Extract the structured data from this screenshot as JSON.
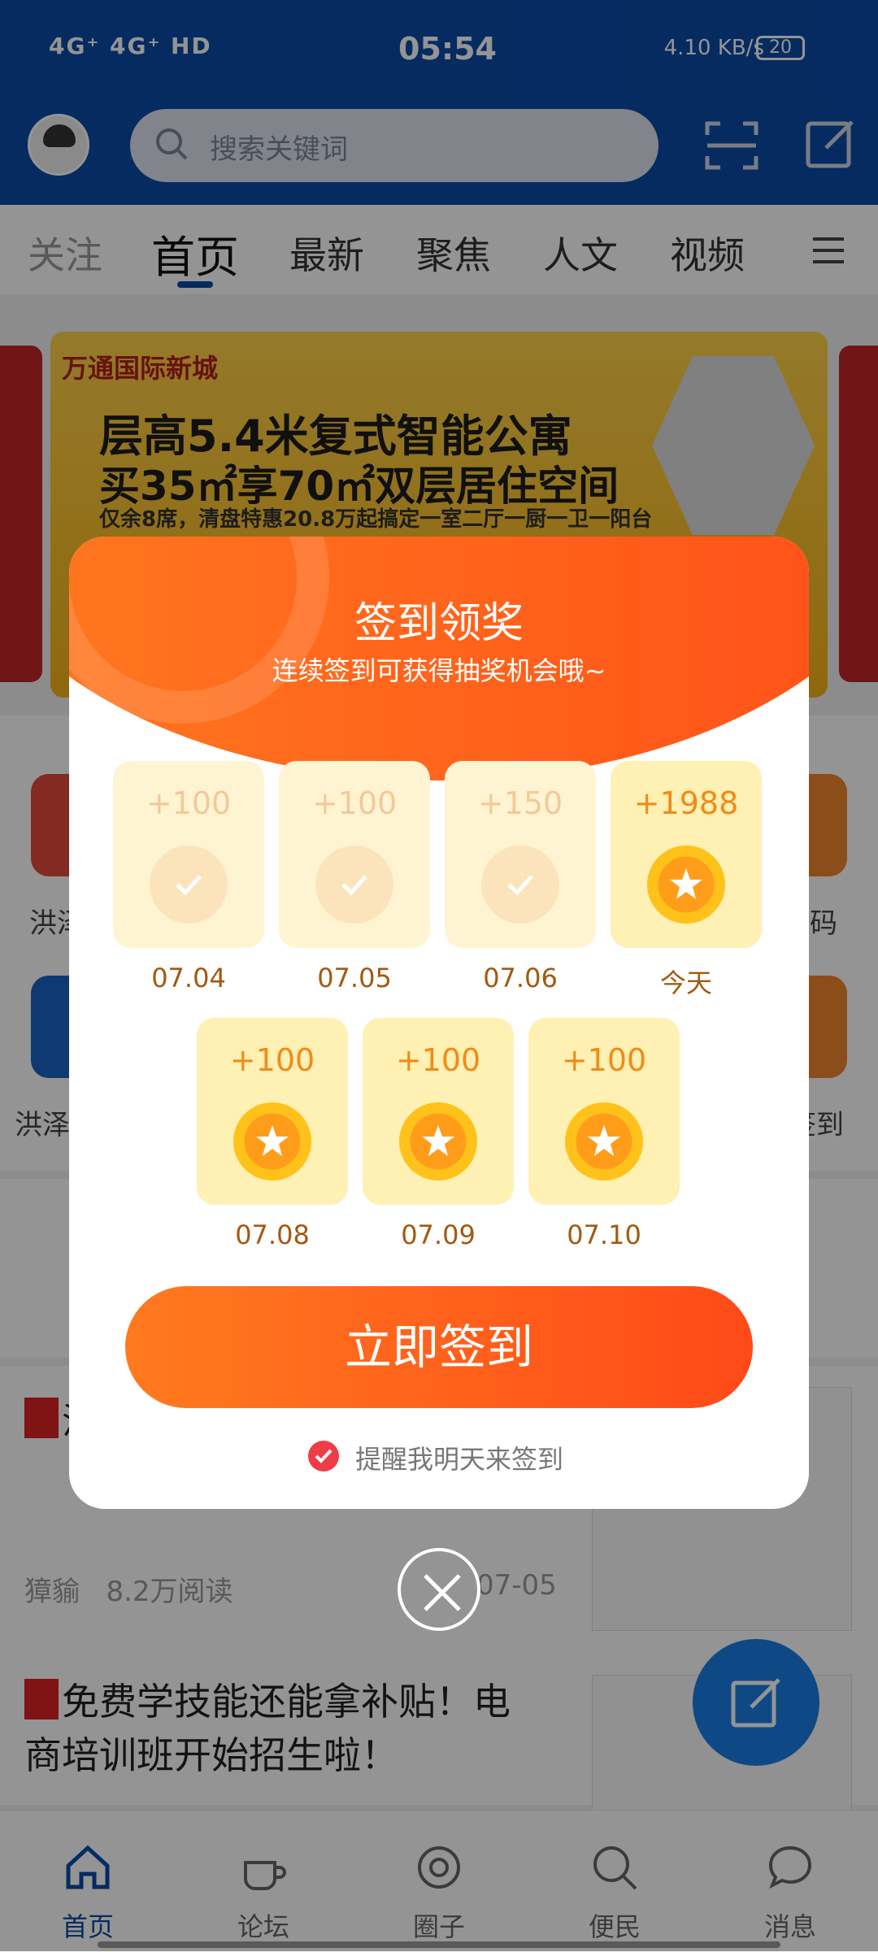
{
  "status_bar": {
    "left": "4G⁺ 4G⁺ HD",
    "time": "05:54",
    "speed": "4.10 KB/s",
    "battery": "20"
  },
  "header": {
    "search_placeholder": "搜索关键词"
  },
  "tabs": [
    "关注",
    "首页",
    "最新",
    "聚焦",
    "人文",
    "视频"
  ],
  "banner": {
    "logo": "万通国际新城",
    "line1": "层高5.4米复式智能公寓",
    "line2": "买35㎡享70㎡双层居住空间",
    "line3": "仅余8席，清盘特惠20.8万起搞定一室二厅一厨一卫一阳台"
  },
  "background_labels": {
    "left_top": "洪泽",
    "left_bottom": "洪泽",
    "right_top": "码",
    "right_bottom": "签到"
  },
  "feed": {
    "item1_title": "注 育",
    "item1_author": "獐貐",
    "item1_reads": "8.2万阅读",
    "item1_date": "07-05",
    "item2_title": "免费学技能还能拿补贴！电商培训班开始招生啦！"
  },
  "bottom_nav": [
    "首页",
    "论坛",
    "圈子",
    "便民",
    "消息"
  ],
  "modal": {
    "title": "签到领奖",
    "subtitle": "连续签到可获得抽奖机会哦~",
    "days": [
      {
        "points": "+100",
        "date": "07.04",
        "state": "past"
      },
      {
        "points": "+100",
        "date": "07.05",
        "state": "past"
      },
      {
        "points": "+150",
        "date": "07.06",
        "state": "past"
      },
      {
        "points": "+1988",
        "date": "今天",
        "state": "today"
      },
      {
        "points": "+100",
        "date": "07.08",
        "state": "future"
      },
      {
        "points": "+100",
        "date": "07.09",
        "state": "future"
      },
      {
        "points": "+100",
        "date": "07.10",
        "state": "future"
      }
    ],
    "sign_button": "立即签到",
    "remind_label": "提醒我明天来签到",
    "remind_checked": true
  },
  "colors": {
    "brand_blue": "#0b4aa8",
    "accent_orange": "#ff5a1a",
    "coin_gold": "#ffb31a"
  }
}
